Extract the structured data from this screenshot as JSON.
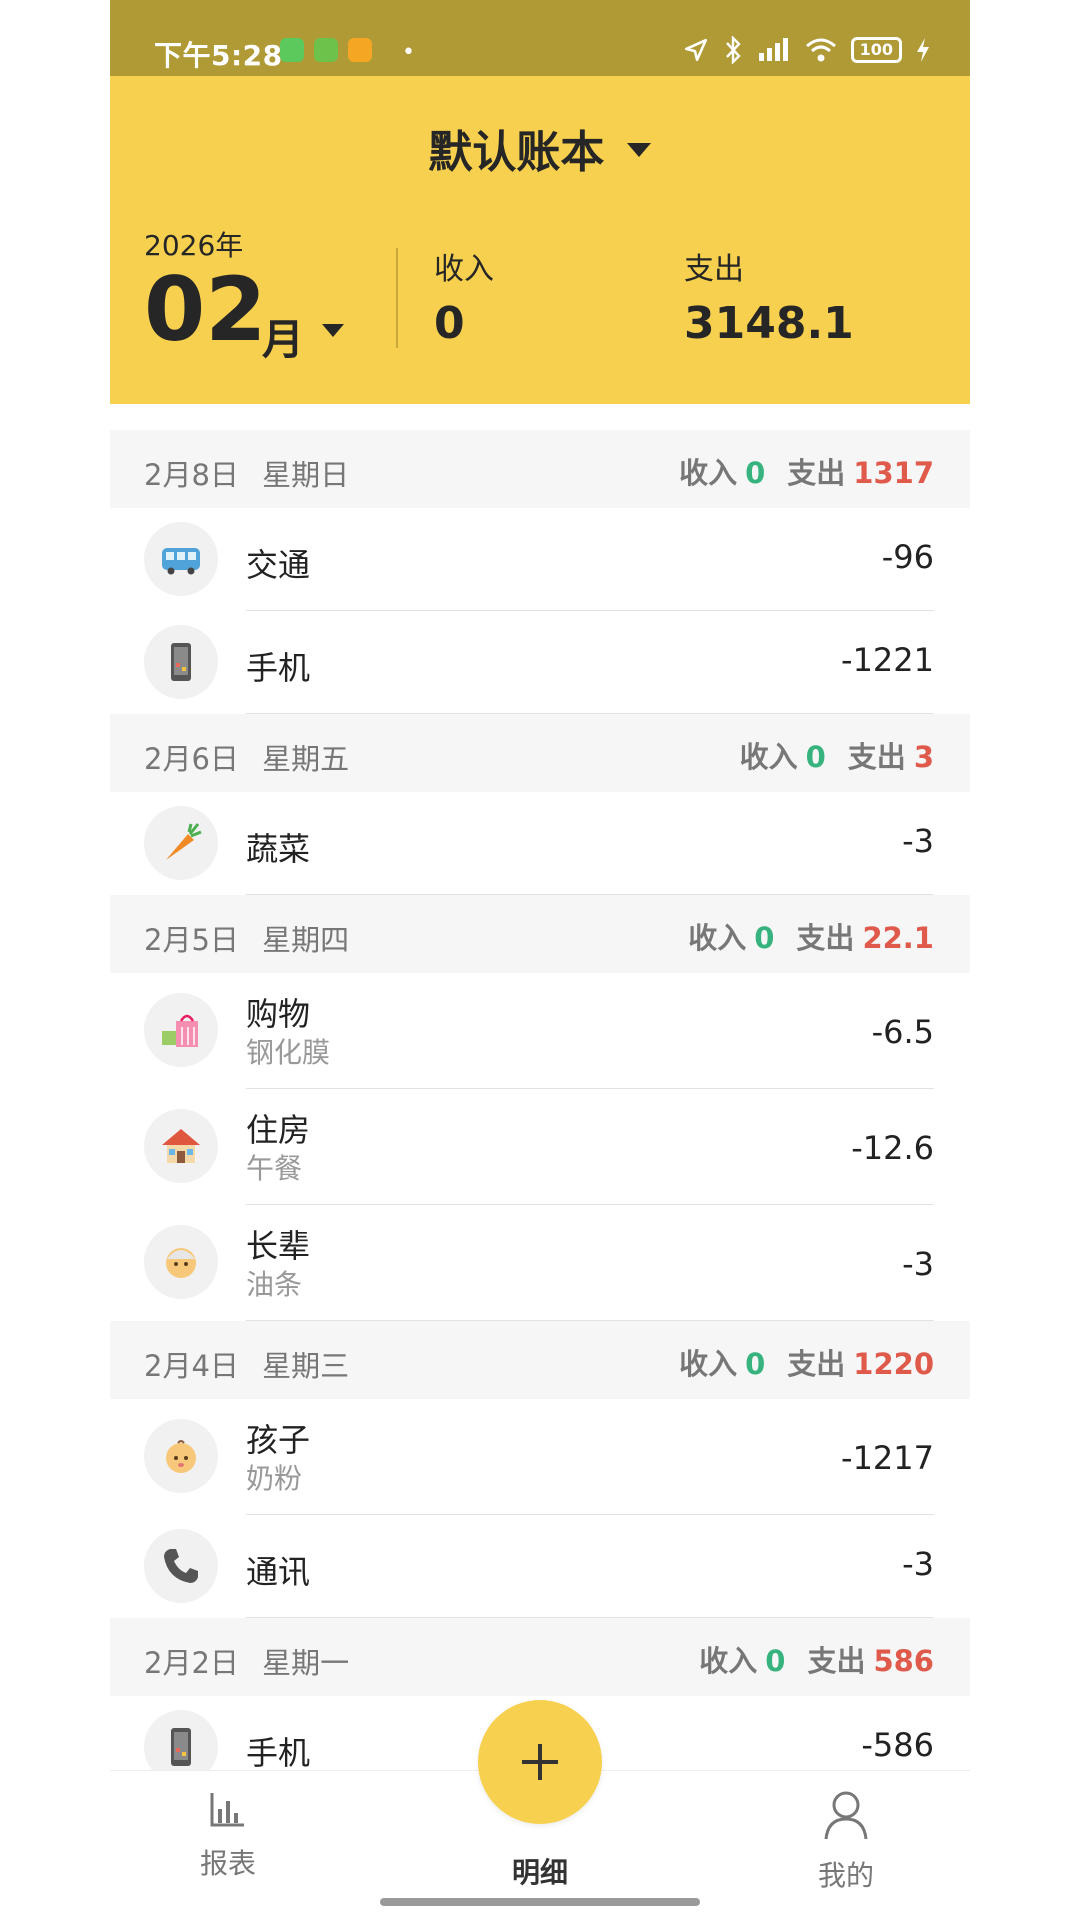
{
  "status_bar": {
    "time": "下午5:28",
    "battery": "100"
  },
  "header": {
    "book_title": "默认账本",
    "year": "2026年",
    "month": "02",
    "month_unit": "月",
    "income_label": "收入",
    "income_value": "0",
    "expense_label": "支出",
    "expense_value": "3148.1"
  },
  "days": [
    {
      "date": "2月8日",
      "weekday": "星期日",
      "income_label": "收入",
      "income": "0",
      "expense_label": "支出",
      "expense": "1317",
      "items": [
        {
          "icon": "bus-icon",
          "name": "交通",
          "note": "",
          "amount": "-96"
        },
        {
          "icon": "phone-icon",
          "name": "手机",
          "note": "",
          "amount": "-1221"
        }
      ]
    },
    {
      "date": "2月6日",
      "weekday": "星期五",
      "income_label": "收入",
      "income": "0",
      "expense_label": "支出",
      "expense": "3",
      "items": [
        {
          "icon": "carrot-icon",
          "name": "蔬菜",
          "note": "",
          "amount": "-3"
        }
      ]
    },
    {
      "date": "2月5日",
      "weekday": "星期四",
      "income_label": "收入",
      "income": "0",
      "expense_label": "支出",
      "expense": "22.1",
      "items": [
        {
          "icon": "shopping-bag-icon",
          "name": "购物",
          "note": "钢化膜",
          "amount": "-6.5"
        },
        {
          "icon": "house-icon",
          "name": "住房",
          "note": "午餐",
          "amount": "-12.6"
        },
        {
          "icon": "elder-icon",
          "name": "长辈",
          "note": "油条",
          "amount": "-3"
        }
      ]
    },
    {
      "date": "2月4日",
      "weekday": "星期三",
      "income_label": "收入",
      "income": "0",
      "expense_label": "支出",
      "expense": "1220",
      "items": [
        {
          "icon": "baby-icon",
          "name": "孩子",
          "note": "奶粉",
          "amount": "-1217"
        },
        {
          "icon": "telephone-icon",
          "name": "通讯",
          "note": "",
          "amount": "-3"
        }
      ]
    },
    {
      "date": "2月2日",
      "weekday": "星期一",
      "income_label": "收入",
      "income": "0",
      "expense_label": "支出",
      "expense": "586",
      "items": [
        {
          "icon": "phone-icon",
          "name": "手机",
          "note": "",
          "amount": "-586"
        }
      ]
    }
  ],
  "tabbar": {
    "reports": "报表",
    "details": "明细",
    "mine": "我的"
  },
  "colors": {
    "header_bg": "#f6d04e",
    "status_bg": "#b09a36",
    "income": "#36b37e",
    "expense": "#e05a4c"
  }
}
